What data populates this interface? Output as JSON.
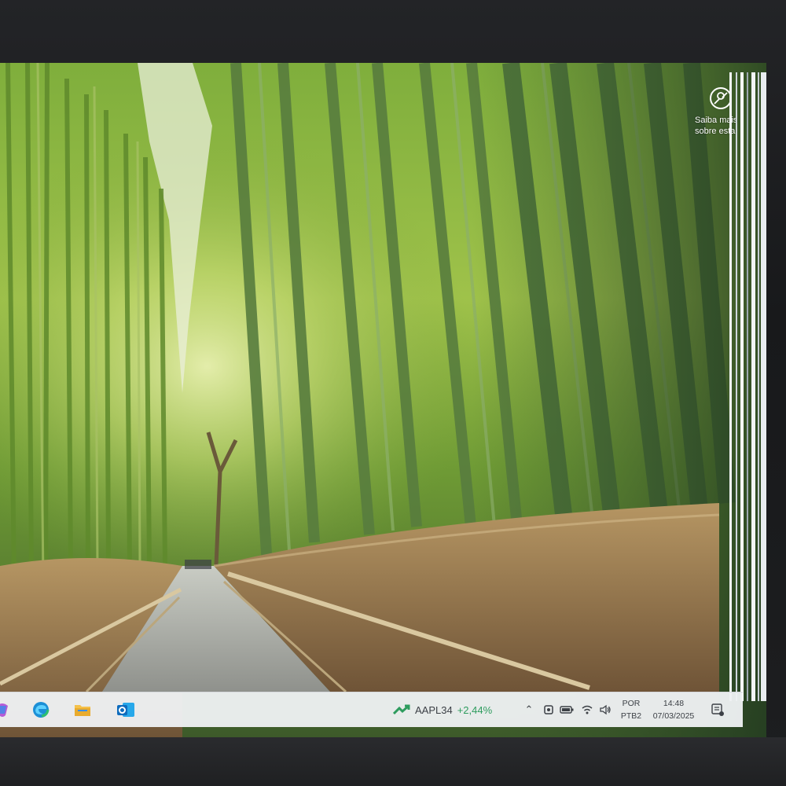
{
  "spotlight": {
    "label_line1": "Saiba mais",
    "label_line2": "sobre esta"
  },
  "taskbar": {
    "apps": [
      {
        "name": "copilot",
        "icon": "copilot-icon"
      },
      {
        "name": "edge",
        "icon": "edge-icon"
      },
      {
        "name": "file-explorer",
        "icon": "folder-icon"
      },
      {
        "name": "outlook",
        "icon": "outlook-icon"
      }
    ],
    "stock": {
      "symbol": "AAPL34",
      "change": "+2,44%",
      "change_color": "#2e9c5e"
    },
    "tray": {
      "language": "POR",
      "keyboard": "PTB2",
      "time": "14:48",
      "date": "07/03/2025"
    }
  },
  "colors": {
    "taskbar_bg": "#eef0f3",
    "accent_edge": "#1c8fd6",
    "outlook_blue": "#0f6cbd"
  }
}
